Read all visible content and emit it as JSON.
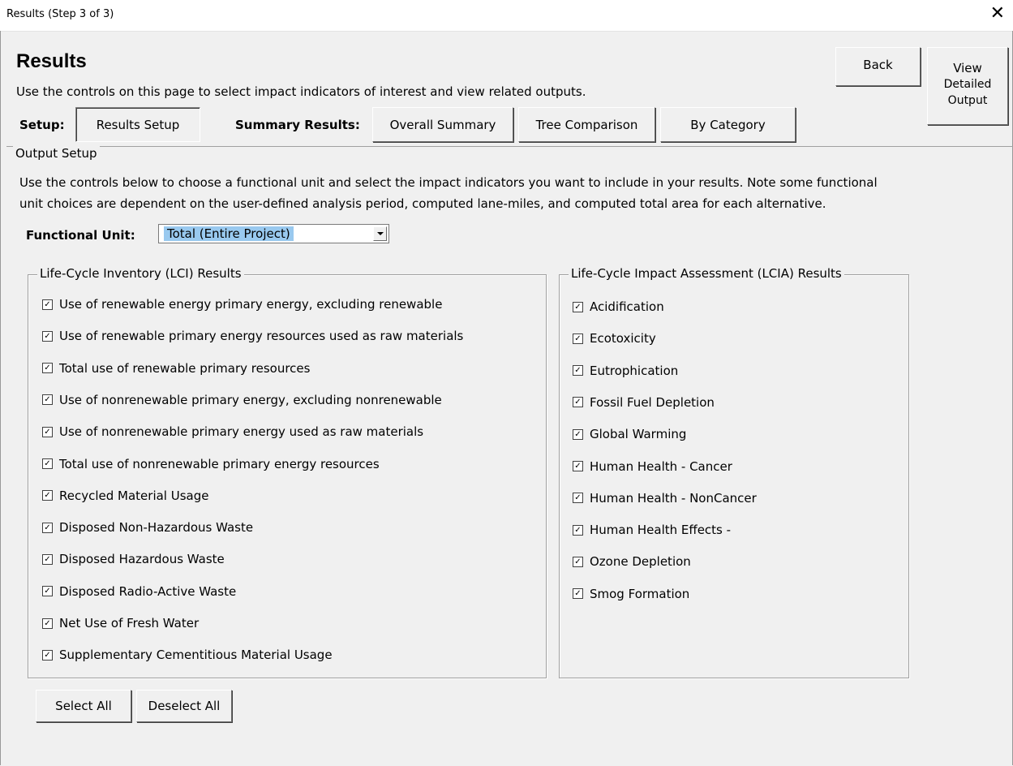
{
  "window": {
    "title": "Results (Step 3 of 3)",
    "close_glyph": "✕"
  },
  "header": {
    "title": "Results",
    "subtitle": "Use the controls on this page to select impact indicators of interest and view related outputs."
  },
  "toolbar": {
    "back_label": "Back",
    "view_detailed_label": [
      "View",
      "Detailed",
      "Output"
    ],
    "setup_label": "Setup:",
    "results_setup_label": "Results Setup",
    "summary_label": "Summary Results:",
    "overall_summary_label": "Overall Summary",
    "tree_comparison_label": "Tree Comparison",
    "by_category_label": "By Category"
  },
  "output_setup": {
    "legend": "Output Setup",
    "description_line1": "Use the controls below to choose a functional unit and select the impact indicators you want to include in your results.  Note some functional",
    "description_line2": "unit choices are dependent on the user-defined analysis period, computed lane-miles, and computed total area for each alternative.",
    "functional_unit_label": "Functional Unit:",
    "functional_unit_value": "Total (Entire Project)"
  },
  "lci": {
    "legend": "Life-Cycle Inventory (LCI) Results",
    "items": [
      {
        "label": "Use of renewable energy primary energy, excluding renewable",
        "checked": true
      },
      {
        "label": "Use of renewable primary energy resources used as raw materials",
        "checked": true
      },
      {
        "label": "Total use of renewable primary resources",
        "checked": true
      },
      {
        "label": "Use of nonrenewable primary energy, excluding nonrenewable",
        "checked": true
      },
      {
        "label": "Use of nonrenewable primary energy used as raw materials",
        "checked": true
      },
      {
        "label": "Total use of nonrenewable primary energy resources",
        "checked": true
      },
      {
        "label": "Recycled Material Usage",
        "checked": true
      },
      {
        "label": "Disposed Non-Hazardous Waste",
        "checked": true
      },
      {
        "label": "Disposed Hazardous Waste",
        "checked": true
      },
      {
        "label": "Disposed Radio-Active Waste",
        "checked": true
      },
      {
        "label": "Net Use of Fresh Water",
        "checked": true
      },
      {
        "label": "Supplementary Cementitious Material Usage",
        "checked": true
      }
    ]
  },
  "lcia": {
    "legend": "Life-Cycle Impact Assessment (LCIA) Results",
    "items": [
      {
        "label": "Acidification",
        "checked": true
      },
      {
        "label": "Ecotoxicity",
        "checked": true
      },
      {
        "label": "Eutrophication",
        "checked": true
      },
      {
        "label": "Fossil Fuel Depletion",
        "checked": true
      },
      {
        "label": "Global Warming",
        "checked": true
      },
      {
        "label": "Human Health - Cancer",
        "checked": true
      },
      {
        "label": "Human Health - NonCancer",
        "checked": true
      },
      {
        "label": "Human Health Effects -",
        "checked": true
      },
      {
        "label": "Ozone Depletion",
        "checked": true
      },
      {
        "label": "Smog Formation",
        "checked": true
      }
    ]
  },
  "actions": {
    "select_all_label": "Select All",
    "deselect_all_label": "Deselect All"
  },
  "check_glyph": "✓"
}
